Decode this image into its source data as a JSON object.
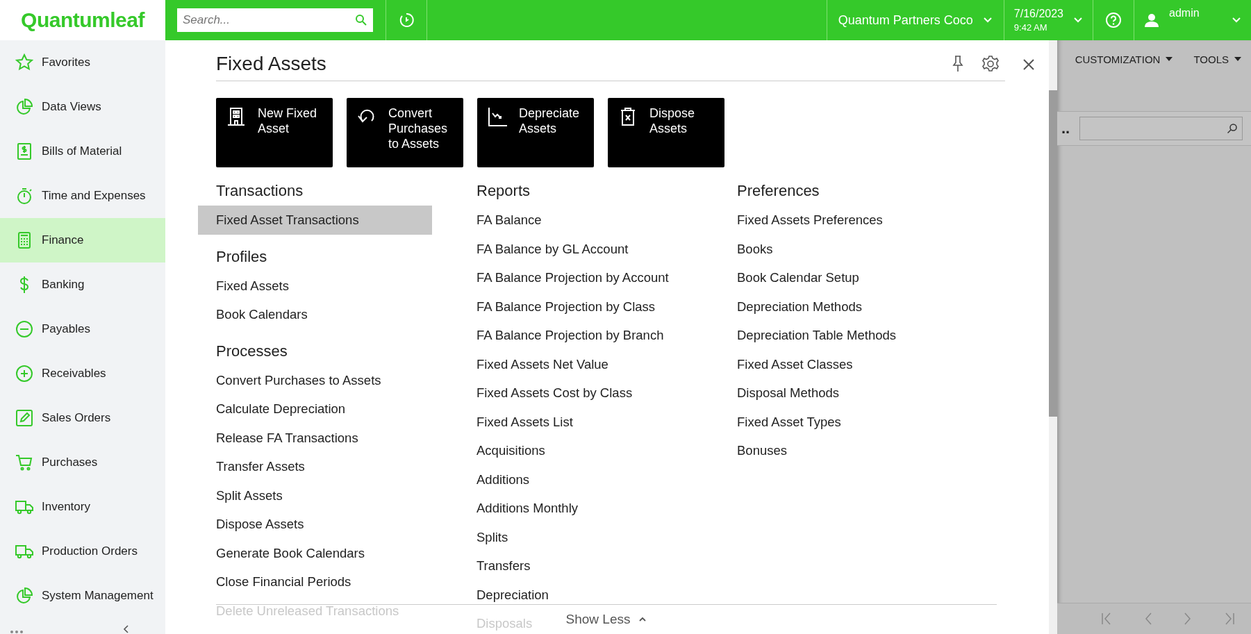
{
  "logo": "Quantumleaf",
  "topbar": {
    "search": {
      "placeholder": "Search..."
    },
    "company": "Quantum Partners Coco",
    "date": "7/16/2023",
    "time": "9:42 AM",
    "user": "admin"
  },
  "sidebar": {
    "items": [
      {
        "label": "Favorites",
        "selected": false
      },
      {
        "label": "Data Views",
        "selected": false
      },
      {
        "label": "Bills of Material",
        "selected": false
      },
      {
        "label": "Time and Expenses",
        "selected": false
      },
      {
        "label": "Finance",
        "selected": true
      },
      {
        "label": "Banking",
        "selected": false
      },
      {
        "label": "Payables",
        "selected": false
      },
      {
        "label": "Receivables",
        "selected": false
      },
      {
        "label": "Sales Orders",
        "selected": false
      },
      {
        "label": "Purchases",
        "selected": false
      },
      {
        "label": "Inventory",
        "selected": false
      },
      {
        "label": "Production Orders",
        "selected": false
      },
      {
        "label": "System Management",
        "selected": false
      }
    ]
  },
  "panel": {
    "title": "Fixed Assets",
    "tiles": [
      {
        "label": "New Fixed Asset"
      },
      {
        "label": "Convert Purchases to Assets"
      },
      {
        "label": "Depreciate Assets"
      },
      {
        "label": "Dispose Assets"
      }
    ],
    "columns": [
      {
        "sections": [
          {
            "heading": "Transactions",
            "items": [
              {
                "label": "Fixed Asset Transactions",
                "selected": true,
                "dimmed": false
              }
            ]
          },
          {
            "heading": "Profiles",
            "items": [
              {
                "label": "Fixed Assets",
                "selected": false,
                "dimmed": false
              },
              {
                "label": "Book Calendars",
                "selected": false,
                "dimmed": false
              }
            ]
          },
          {
            "heading": "Processes",
            "items": [
              {
                "label": "Convert Purchases to Assets",
                "selected": false,
                "dimmed": false
              },
              {
                "label": "Calculate Depreciation",
                "selected": false,
                "dimmed": false
              },
              {
                "label": "Release FA Transactions",
                "selected": false,
                "dimmed": false
              },
              {
                "label": "Transfer Assets",
                "selected": false,
                "dimmed": false
              },
              {
                "label": "Split Assets",
                "selected": false,
                "dimmed": false
              },
              {
                "label": "Dispose Assets",
                "selected": false,
                "dimmed": false
              },
              {
                "label": "Generate Book Calendars",
                "selected": false,
                "dimmed": false
              },
              {
                "label": "Close Financial Periods",
                "selected": false,
                "dimmed": false
              },
              {
                "label": "Delete Unreleased Transactions",
                "selected": false,
                "dimmed": true
              }
            ]
          }
        ]
      },
      {
        "sections": [
          {
            "heading": "Reports",
            "items": [
              {
                "label": "FA Balance",
                "selected": false,
                "dimmed": false
              },
              {
                "label": "FA Balance by GL Account",
                "selected": false,
                "dimmed": false
              },
              {
                "label": "FA Balance Projection by Account",
                "selected": false,
                "dimmed": false
              },
              {
                "label": "FA Balance Projection by Class",
                "selected": false,
                "dimmed": false
              },
              {
                "label": "FA Balance Projection by Branch",
                "selected": false,
                "dimmed": false
              },
              {
                "label": "Fixed Assets Net Value",
                "selected": false,
                "dimmed": false
              },
              {
                "label": "Fixed Assets Cost by Class",
                "selected": false,
                "dimmed": false
              },
              {
                "label": "Fixed Assets List",
                "selected": false,
                "dimmed": false
              },
              {
                "label": "Acquisitions",
                "selected": false,
                "dimmed": false
              },
              {
                "label": "Additions",
                "selected": false,
                "dimmed": false
              },
              {
                "label": "Additions Monthly",
                "selected": false,
                "dimmed": false
              },
              {
                "label": "Splits",
                "selected": false,
                "dimmed": false
              },
              {
                "label": "Transfers",
                "selected": false,
                "dimmed": false
              },
              {
                "label": "Depreciation",
                "selected": false,
                "dimmed": false
              },
              {
                "label": "Disposals",
                "selected": false,
                "dimmed": true
              }
            ]
          }
        ]
      },
      {
        "sections": [
          {
            "heading": "Preferences",
            "items": [
              {
                "label": "Fixed Assets Preferences",
                "selected": false,
                "dimmed": false
              },
              {
                "label": "Books",
                "selected": false,
                "dimmed": false
              },
              {
                "label": "Book Calendar Setup",
                "selected": false,
                "dimmed": false
              },
              {
                "label": "Depreciation Methods",
                "selected": false,
                "dimmed": false
              },
              {
                "label": "Depreciation Table Methods",
                "selected": false,
                "dimmed": false
              },
              {
                "label": "Fixed Asset Classes",
                "selected": false,
                "dimmed": false
              },
              {
                "label": "Disposal Methods",
                "selected": false,
                "dimmed": false
              },
              {
                "label": "Fixed Asset Types",
                "selected": false,
                "dimmed": false
              },
              {
                "label": "Bonuses",
                "selected": false,
                "dimmed": false
              }
            ]
          }
        ]
      }
    ],
    "footer": "Show Less"
  },
  "background": {
    "toolbar": [
      "CUSTOMIZATION",
      "TOOLS"
    ],
    "cut_text": ".."
  }
}
